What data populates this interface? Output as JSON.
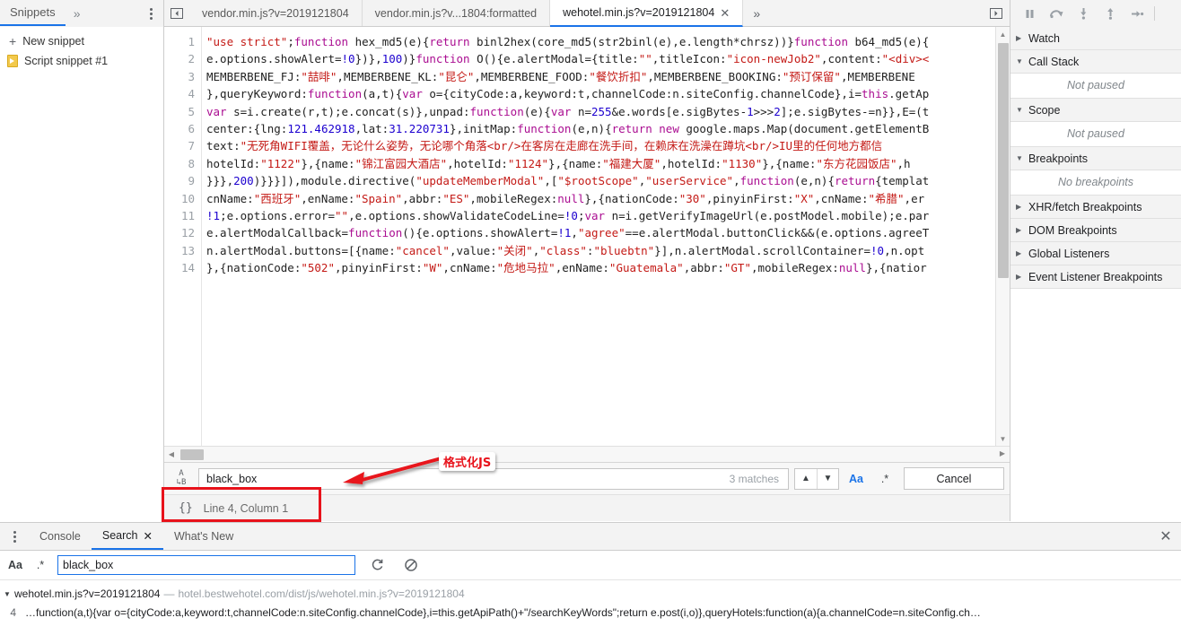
{
  "navigator": {
    "tab_label": "Snippets",
    "more_icon": "chevron-double-right-icon",
    "menu_icon": "vertical-dots-icon",
    "items": [
      {
        "label": "New snippet",
        "icon": "plus-icon"
      },
      {
        "label": "Script snippet #1",
        "icon": "snippet-file-icon"
      }
    ]
  },
  "tabstrip": {
    "panel_toggle_left_icon": "show-navigator-icon",
    "panel_toggle_right_icon": "show-debugger-icon",
    "more_icon": "chevron-double-right-icon",
    "tabs": [
      {
        "label": "vendor.min.js?v=2019121804",
        "active": false,
        "closable": false
      },
      {
        "label": "vendor.min.js?v...1804:formatted",
        "active": false,
        "closable": false
      },
      {
        "label": "wehotel.min.js?v=2019121804",
        "active": true,
        "closable": true,
        "close_icon": "close-icon"
      }
    ]
  },
  "debugger_toolbar": {
    "buttons": [
      {
        "icon": "pause-icon",
        "title": "Pause script execution"
      },
      {
        "icon": "step-over-icon",
        "title": "Step over next function call"
      },
      {
        "icon": "step-into-icon",
        "title": "Step into next function call"
      },
      {
        "icon": "step-out-icon",
        "title": "Step out of current function"
      },
      {
        "icon": "step-icon",
        "title": "Step"
      }
    ]
  },
  "editor": {
    "line_numbers": [
      "1",
      "2",
      "3",
      "4",
      "5",
      "6",
      "7",
      "8",
      "9",
      "10",
      "11",
      "12",
      "13",
      "14"
    ],
    "lines": [
      [
        {
          "t": "\"use strict\"",
          "c": "str"
        },
        {
          "t": ";",
          "c": "plain"
        },
        {
          "t": "function",
          "c": "kw"
        },
        {
          "t": " hex_md5(e){",
          "c": "plain"
        },
        {
          "t": "return",
          "c": "kw"
        },
        {
          "t": " binl2hex(core_md5(str2binl(e),e.length*chrsz))}",
          "c": "plain"
        },
        {
          "t": "function",
          "c": "kw"
        },
        {
          "t": " b64_md5(e){",
          "c": "plain"
        }
      ],
      [
        {
          "t": "e.options.showAlert=",
          "c": "plain"
        },
        {
          "t": "!0",
          "c": "num"
        },
        {
          "t": "})},",
          "c": "plain"
        },
        {
          "t": "100",
          "c": "num"
        },
        {
          "t": ")}",
          "c": "plain"
        },
        {
          "t": "function",
          "c": "kw"
        },
        {
          "t": " O(){e.alertModal={title:",
          "c": "plain"
        },
        {
          "t": "\"\"",
          "c": "str"
        },
        {
          "t": ",titleIcon:",
          "c": "plain"
        },
        {
          "t": "\"icon-newJob2\"",
          "c": "str"
        },
        {
          "t": ",content:",
          "c": "plain"
        },
        {
          "t": "\"<div><",
          "c": "str"
        }
      ],
      [
        {
          "t": "MEMBERBENE_FJ:",
          "c": "plain"
        },
        {
          "t": "\"喆啡\"",
          "c": "str"
        },
        {
          "t": ",MEMBERBENE_KL:",
          "c": "plain"
        },
        {
          "t": "\"昆仑\"",
          "c": "str"
        },
        {
          "t": ",MEMBERBENE_FOOD:",
          "c": "plain"
        },
        {
          "t": "\"餐饮折扣\"",
          "c": "str"
        },
        {
          "t": ",MEMBERBENE_BOOKING:",
          "c": "plain"
        },
        {
          "t": "\"预订保留\"",
          "c": "str"
        },
        {
          "t": ",MEMBERBENE",
          "c": "plain"
        }
      ],
      [
        {
          "t": "},queryKeyword:",
          "c": "plain"
        },
        {
          "t": "function",
          "c": "kw"
        },
        {
          "t": "(a,t){",
          "c": "plain"
        },
        {
          "t": "var",
          "c": "kw"
        },
        {
          "t": " o={cityCode:a,keyword:t,channelCode:n.siteConfig.channelCode},i=",
          "c": "plain"
        },
        {
          "t": "this",
          "c": "kw"
        },
        {
          "t": ".getAp",
          "c": "plain"
        }
      ],
      [
        {
          "t": "var",
          "c": "kw"
        },
        {
          "t": " s=i.create(r,t);e.concat(s)},unpad:",
          "c": "plain"
        },
        {
          "t": "function",
          "c": "kw"
        },
        {
          "t": "(e){",
          "c": "plain"
        },
        {
          "t": "var",
          "c": "kw"
        },
        {
          "t": " n=",
          "c": "plain"
        },
        {
          "t": "255",
          "c": "num"
        },
        {
          "t": "&e.words[e.sigBytes-",
          "c": "plain"
        },
        {
          "t": "1",
          "c": "num"
        },
        {
          "t": ">>>",
          "c": "plain"
        },
        {
          "t": "2",
          "c": "num"
        },
        {
          "t": "];e.sigBytes-=n}},E=(t",
          "c": "plain"
        }
      ],
      [
        {
          "t": "center:{lng:",
          "c": "plain"
        },
        {
          "t": "121.462918",
          "c": "num"
        },
        {
          "t": ",lat:",
          "c": "plain"
        },
        {
          "t": "31.220731",
          "c": "num"
        },
        {
          "t": "},initMap:",
          "c": "plain"
        },
        {
          "t": "function",
          "c": "kw"
        },
        {
          "t": "(e,n){",
          "c": "plain"
        },
        {
          "t": "return",
          "c": "kw"
        },
        {
          "t": " ",
          "c": "plain"
        },
        {
          "t": "new",
          "c": "kw"
        },
        {
          "t": " google.maps.Map(document.getElementB",
          "c": "plain"
        }
      ],
      [
        {
          "t": "text:",
          "c": "plain"
        },
        {
          "t": "\"无死角WIFI覆盖，无论什么姿势，无论哪个角落<br/>在客房在走廊在洗手间，在赖床在洗澡在蹲坑<br/>IU里的任何地方都信",
          "c": "str"
        }
      ],
      [
        {
          "t": "hotelId:",
          "c": "plain"
        },
        {
          "t": "\"1122\"",
          "c": "str"
        },
        {
          "t": "},{name:",
          "c": "plain"
        },
        {
          "t": "\"锦江富园大酒店\"",
          "c": "str"
        },
        {
          "t": ",hotelId:",
          "c": "plain"
        },
        {
          "t": "\"1124\"",
          "c": "str"
        },
        {
          "t": "},{name:",
          "c": "plain"
        },
        {
          "t": "\"福建大厦\"",
          "c": "str"
        },
        {
          "t": ",hotelId:",
          "c": "plain"
        },
        {
          "t": "\"1130\"",
          "c": "str"
        },
        {
          "t": "},{name:",
          "c": "plain"
        },
        {
          "t": "\"东方花园饭店\"",
          "c": "str"
        },
        {
          "t": ",h",
          "c": "plain"
        }
      ],
      [
        {
          "t": "}}},",
          "c": "plain"
        },
        {
          "t": "200",
          "c": "num"
        },
        {
          "t": ")}}}]),module.directive(",
          "c": "plain"
        },
        {
          "t": "\"updateMemberModal\"",
          "c": "str"
        },
        {
          "t": ",[",
          "c": "plain"
        },
        {
          "t": "\"$rootScope\"",
          "c": "str"
        },
        {
          "t": ",",
          "c": "plain"
        },
        {
          "t": "\"userService\"",
          "c": "str"
        },
        {
          "t": ",",
          "c": "plain"
        },
        {
          "t": "function",
          "c": "kw"
        },
        {
          "t": "(e,n){",
          "c": "plain"
        },
        {
          "t": "return",
          "c": "kw"
        },
        {
          "t": "{templat",
          "c": "plain"
        }
      ],
      [
        {
          "t": "cnName:",
          "c": "plain"
        },
        {
          "t": "\"西班牙\"",
          "c": "str"
        },
        {
          "t": ",enName:",
          "c": "plain"
        },
        {
          "t": "\"Spain\"",
          "c": "str"
        },
        {
          "t": ",abbr:",
          "c": "plain"
        },
        {
          "t": "\"ES\"",
          "c": "str"
        },
        {
          "t": ",mobileRegex:",
          "c": "plain"
        },
        {
          "t": "null",
          "c": "kw"
        },
        {
          "t": "},{nationCode:",
          "c": "plain"
        },
        {
          "t": "\"30\"",
          "c": "str"
        },
        {
          "t": ",pinyinFirst:",
          "c": "plain"
        },
        {
          "t": "\"X\"",
          "c": "str"
        },
        {
          "t": ",cnName:",
          "c": "plain"
        },
        {
          "t": "\"希腊\"",
          "c": "str"
        },
        {
          "t": ",er",
          "c": "plain"
        }
      ],
      [
        {
          "t": "!1",
          "c": "num"
        },
        {
          "t": ";e.options.error=",
          "c": "plain"
        },
        {
          "t": "\"\"",
          "c": "str"
        },
        {
          "t": ",e.options.showValidateCodeLine=",
          "c": "plain"
        },
        {
          "t": "!0",
          "c": "num"
        },
        {
          "t": ";",
          "c": "plain"
        },
        {
          "t": "var",
          "c": "kw"
        },
        {
          "t": " n=i.getVerifyImageUrl(e.postModel.mobile);e.par",
          "c": "plain"
        }
      ],
      [
        {
          "t": "e.alertModalCallback=",
          "c": "plain"
        },
        {
          "t": "function",
          "c": "kw"
        },
        {
          "t": "(){e.options.showAlert=",
          "c": "plain"
        },
        {
          "t": "!1",
          "c": "num"
        },
        {
          "t": ",",
          "c": "plain"
        },
        {
          "t": "\"agree\"",
          "c": "str"
        },
        {
          "t": "==e.alertModal.buttonClick&&(e.options.agreeT",
          "c": "plain"
        }
      ],
      [
        {
          "t": "n.alertModal.buttons=[{name:",
          "c": "plain"
        },
        {
          "t": "\"cancel\"",
          "c": "str"
        },
        {
          "t": ",value:",
          "c": "plain"
        },
        {
          "t": "\"关闭\"",
          "c": "str"
        },
        {
          "t": ",",
          "c": "plain"
        },
        {
          "t": "\"class\"",
          "c": "str"
        },
        {
          "t": ":",
          "c": "plain"
        },
        {
          "t": "\"bluebtn\"",
          "c": "str"
        },
        {
          "t": "}],n.alertModal.scrollContainer=",
          "c": "plain"
        },
        {
          "t": "!0",
          "c": "num"
        },
        {
          "t": ",n.opt",
          "c": "plain"
        }
      ],
      [
        {
          "t": "},{nationCode:",
          "c": "plain"
        },
        {
          "t": "\"502\"",
          "c": "str"
        },
        {
          "t": ",pinyinFirst:",
          "c": "plain"
        },
        {
          "t": "\"W\"",
          "c": "str"
        },
        {
          "t": ",cnName:",
          "c": "plain"
        },
        {
          "t": "\"危地马拉\"",
          "c": "str"
        },
        {
          "t": ",enName:",
          "c": "plain"
        },
        {
          "t": "\"Guatemala\"",
          "c": "str"
        },
        {
          "t": ",abbr:",
          "c": "plain"
        },
        {
          "t": "\"GT\"",
          "c": "str"
        },
        {
          "t": ",mobileRegex:",
          "c": "plain"
        },
        {
          "t": "null",
          "c": "kw"
        },
        {
          "t": "},{natior",
          "c": "plain"
        }
      ]
    ]
  },
  "findbar": {
    "icon": "match-case-ab-icon",
    "value": "black_box",
    "placeholder": "Find",
    "matches": "3 matches",
    "prev_icon": "chevron-up-icon",
    "next_icon": "chevron-down-icon",
    "match_case_label": "Aa",
    "regex_label": ".*",
    "cancel_label": "Cancel"
  },
  "statusbar": {
    "pretty_print_icon": "{}",
    "position": "Line 4, Column 1"
  },
  "annotation": {
    "label": "格式化JS",
    "color": "#e8121b"
  },
  "debug_pane": {
    "sections": [
      {
        "label": "Watch",
        "expanded": false,
        "body": null
      },
      {
        "label": "Call Stack",
        "expanded": true,
        "body": "Not paused"
      },
      {
        "label": "Scope",
        "expanded": true,
        "body": "Not paused"
      },
      {
        "label": "Breakpoints",
        "expanded": true,
        "body": "No breakpoints"
      },
      {
        "label": "XHR/fetch Breakpoints",
        "expanded": false,
        "body": null
      },
      {
        "label": "DOM Breakpoints",
        "expanded": false,
        "body": null
      },
      {
        "label": "Global Listeners",
        "expanded": false,
        "body": null
      },
      {
        "label": "Event Listener Breakpoints",
        "expanded": false,
        "body": null
      }
    ]
  },
  "drawer": {
    "menu_icon": "vertical-dots-icon",
    "close_icon": "close-icon",
    "tabs": [
      {
        "label": "Console",
        "active": false,
        "closable": false
      },
      {
        "label": "Search",
        "active": true,
        "closable": true,
        "close_icon": "close-icon"
      },
      {
        "label": "What's New",
        "active": false,
        "closable": false
      }
    ],
    "search": {
      "match_case_label": "Aa",
      "regex_label": ".*",
      "value": "black_box",
      "placeholder": "Search",
      "refresh_icon": "refresh-icon",
      "clear_icon": "clear-icon"
    },
    "results": [
      {
        "expanded": true,
        "file": "wehotel.min.js?v=2019121804",
        "dash": "—",
        "url": "hotel.bestwehotel.com/dist/js/wehotel.min.js?v=2019121804",
        "matches": [
          {
            "line": "4",
            "snippet": "…function(a,t){var o={cityCode:a,keyword:t,channelCode:n.siteConfig.channelCode},i=this.getApiPath()+\"/searchKeyWords\";return e.post(i,o)},queryHotels:function(a){a.channelCode=n.siteConfig.ch…"
          }
        ]
      }
    ]
  }
}
